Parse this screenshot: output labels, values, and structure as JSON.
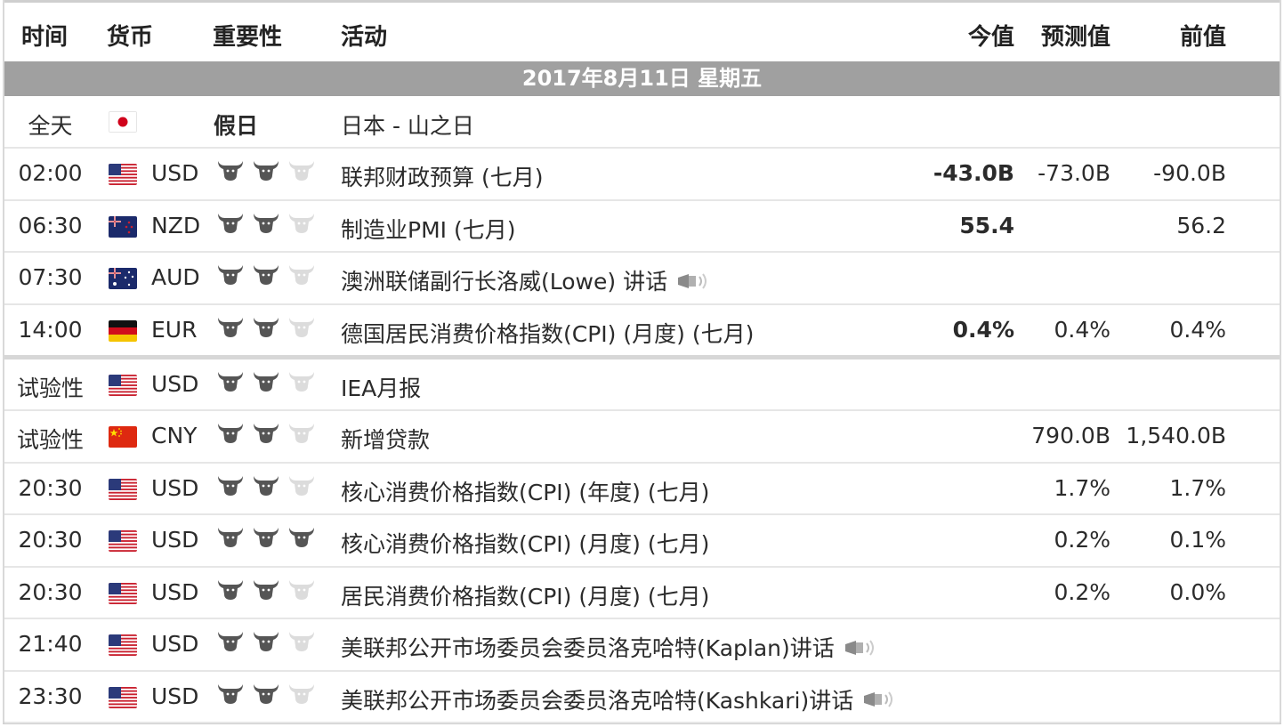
{
  "header": {
    "time": "时间",
    "currency": "货币",
    "importance": "重要性",
    "event": "活动",
    "actual": "今值",
    "forecast": "预测值",
    "previous": "前值"
  },
  "date_label": "2017年8月11日  星期五",
  "colors": {
    "actual_negative": "#e10000",
    "bull_on": "#555555",
    "bull_off": "#dcdcdc",
    "datebar": "#a0a0a0"
  },
  "holiday": {
    "time": "全天",
    "flag": "japan-flag",
    "label": "假日",
    "event": "日本 - 山之日"
  },
  "events": [
    {
      "time": "02:00",
      "currency": "USD",
      "flag": "us-flag",
      "importance": 2,
      "event": "联邦财政预算 (七月)",
      "actual": "-43.0B",
      "actual_color": "red",
      "forecast": "-73.0B",
      "previous": "-90.0B",
      "speech": false
    },
    {
      "time": "06:30",
      "currency": "NZD",
      "flag": "nz-flag",
      "importance": 2,
      "event": "制造业PMI (七月)",
      "actual": "55.4",
      "actual_color": "black",
      "forecast": "",
      "previous": "56.2",
      "speech": false
    },
    {
      "time": "07:30",
      "currency": "AUD",
      "flag": "au-flag",
      "importance": 2,
      "event": "澳洲联储副行长洛威(Lowe) 讲话",
      "actual": "",
      "actual_color": "black",
      "forecast": "",
      "previous": "",
      "speech": true
    },
    {
      "time": "14:00",
      "currency": "EUR",
      "flag": "de-flag",
      "importance": 2,
      "event": "德国居民消费价格指数(CPI) (月度) (七月)",
      "actual": "0.4%",
      "actual_color": "black",
      "forecast": "0.4%",
      "previous": "0.4%",
      "speech": false
    },
    {
      "time": "试验性",
      "currency": "USD",
      "flag": "us-flag",
      "importance": 2,
      "event": "IEA月报",
      "actual": "",
      "actual_color": "black",
      "forecast": "",
      "previous": "",
      "speech": false
    },
    {
      "time": "试验性",
      "currency": "CNY",
      "flag": "cn-flag",
      "importance": 2,
      "event": "新增贷款",
      "actual": "",
      "actual_color": "black",
      "forecast": "790.0B",
      "previous": "1,540.0B",
      "speech": false
    },
    {
      "time": "20:30",
      "currency": "USD",
      "flag": "us-flag",
      "importance": 2,
      "event": "核心消费价格指数(CPI) (年度) (七月)",
      "actual": "",
      "actual_color": "black",
      "forecast": "1.7%",
      "previous": "1.7%",
      "speech": false
    },
    {
      "time": "20:30",
      "currency": "USD",
      "flag": "us-flag",
      "importance": 3,
      "event": "核心消费价格指数(CPI) (月度) (七月)",
      "actual": "",
      "actual_color": "black",
      "forecast": "0.2%",
      "previous": "0.1%",
      "speech": false
    },
    {
      "time": "20:30",
      "currency": "USD",
      "flag": "us-flag",
      "importance": 2,
      "event": "居民消费价格指数(CPI) (月度) (七月)",
      "actual": "",
      "actual_color": "black",
      "forecast": "0.2%",
      "previous": "0.0%",
      "speech": false
    },
    {
      "time": "21:40",
      "currency": "USD",
      "flag": "us-flag",
      "importance": 2,
      "event": "美联邦公开市场委员会委员洛克哈特(Kaplan)讲话",
      "actual": "",
      "actual_color": "black",
      "forecast": "",
      "previous": "",
      "speech": true
    },
    {
      "time": "23:30",
      "currency": "USD",
      "flag": "us-flag",
      "importance": 2,
      "event": "美联邦公开市场委员会委员洛克哈特(Kashkari)讲话",
      "actual": "",
      "actual_color": "black",
      "forecast": "",
      "previous": "",
      "speech": true
    }
  ]
}
